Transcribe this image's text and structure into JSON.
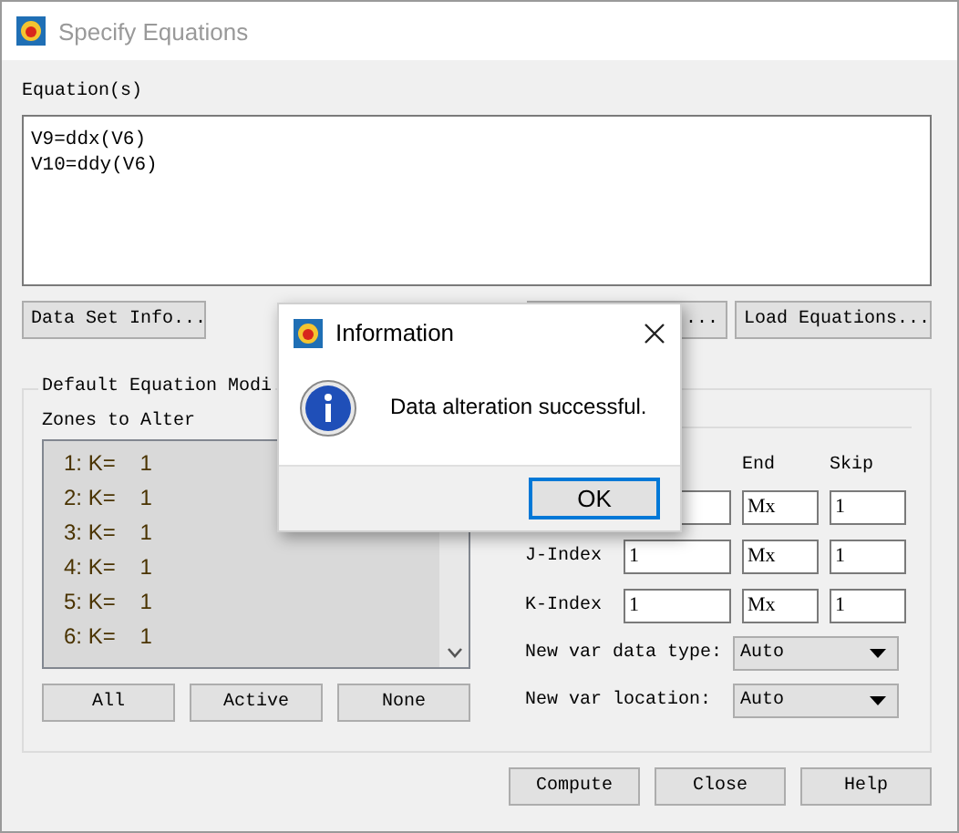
{
  "window": {
    "title": "Specify Equations"
  },
  "equations": {
    "label": "Equation(s)",
    "lines": [
      "V9=ddx(V6)",
      "V10=ddy(V6)"
    ]
  },
  "top_buttons": [
    "Data Set Info...",
    "...",
    "Load Equations..."
  ],
  "group": {
    "title": "Default Equation Modi",
    "zones_label": "Zones to Alter",
    "zones": [
      "1: K=    1",
      "2: K=    1",
      "3: K=    1",
      "4: K=    1",
      "5: K=    1",
      "6: K=    1"
    ],
    "zone_buttons": [
      "All",
      "Active",
      "None"
    ],
    "index_headers": [
      "End",
      "Skip"
    ],
    "index_rows": [
      {
        "end": "Mx",
        "skip": "1"
      },
      {
        "label": "J-Index",
        "start": "1",
        "end": "Mx",
        "skip": "1"
      },
      {
        "label": "K-Index",
        "start": "1",
        "end": "Mx",
        "skip": "1"
      }
    ],
    "dropdowns": [
      {
        "label": "New var data type:",
        "value": "Auto"
      },
      {
        "label": "New var location:",
        "value": "Auto"
      }
    ]
  },
  "bottom_buttons": [
    "Compute",
    "Close",
    "Help"
  ],
  "dialog": {
    "title": "Information",
    "message": "Data alteration successful.",
    "button": "OK"
  }
}
